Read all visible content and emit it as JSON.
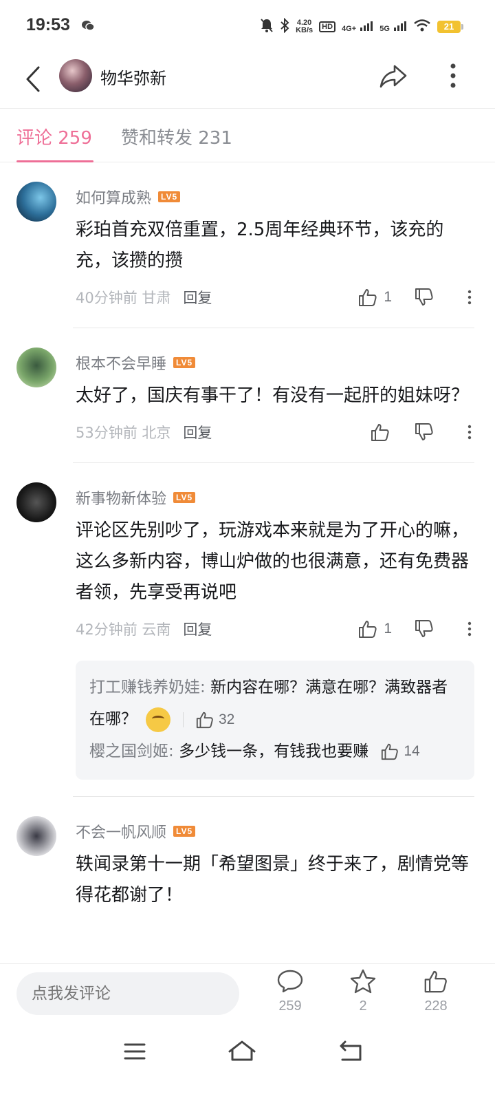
{
  "status_bar": {
    "time": "19:53",
    "net_speed_value": "4.20",
    "net_speed_unit": "KB/s",
    "hd_badge": "HD",
    "sim1": "4G+",
    "sim2": "5G",
    "battery": "21"
  },
  "header": {
    "title": "物华弥新"
  },
  "tabs": [
    {
      "label": "评论 259",
      "active": true
    },
    {
      "label": "赞和转发 231",
      "active": false
    }
  ],
  "comments": [
    {
      "username": "如何算成熟",
      "level": "LV5",
      "text": "彩珀首充双倍重置，2.5周年经典环节，该充的充，该攒的攒",
      "time": "40分钟前",
      "location": "甘肃",
      "reply_label": "回复",
      "likes": "1"
    },
    {
      "username": "根本不会早睡",
      "level": "LV5",
      "text": "太好了，国庆有事干了！有没有一起肝的姐妹呀？",
      "time": "53分钟前",
      "location": "北京",
      "reply_label": "回复",
      "likes": ""
    },
    {
      "username": "新事物新体验",
      "level": "LV5",
      "text": "评论区先别吵了，玩游戏本来就是为了开心的嘛，这么多新内容，博山炉做的也很满意，还有免费器者领，先享受再说吧",
      "time": "42分钟前",
      "location": "云南",
      "reply_label": "回复",
      "likes": "1",
      "replies": [
        {
          "name": "打工赚钱养奶娃",
          "text": "新内容在哪？满意在哪？满致器者在哪？",
          "likes": "32"
        },
        {
          "name": "樱之国剑姬",
          "text": "多少钱一条，有钱我也要赚",
          "likes": "14"
        }
      ]
    },
    {
      "username": "不会一帆风顺",
      "level": "LV5",
      "text": "轶闻录第十一期「希望图景」终于来了，剧情党等得花都谢了！"
    }
  ],
  "bottom_bar": {
    "placeholder": "点我发评论",
    "comment_count": "259",
    "favorite_count": "2",
    "like_count": "228"
  }
}
